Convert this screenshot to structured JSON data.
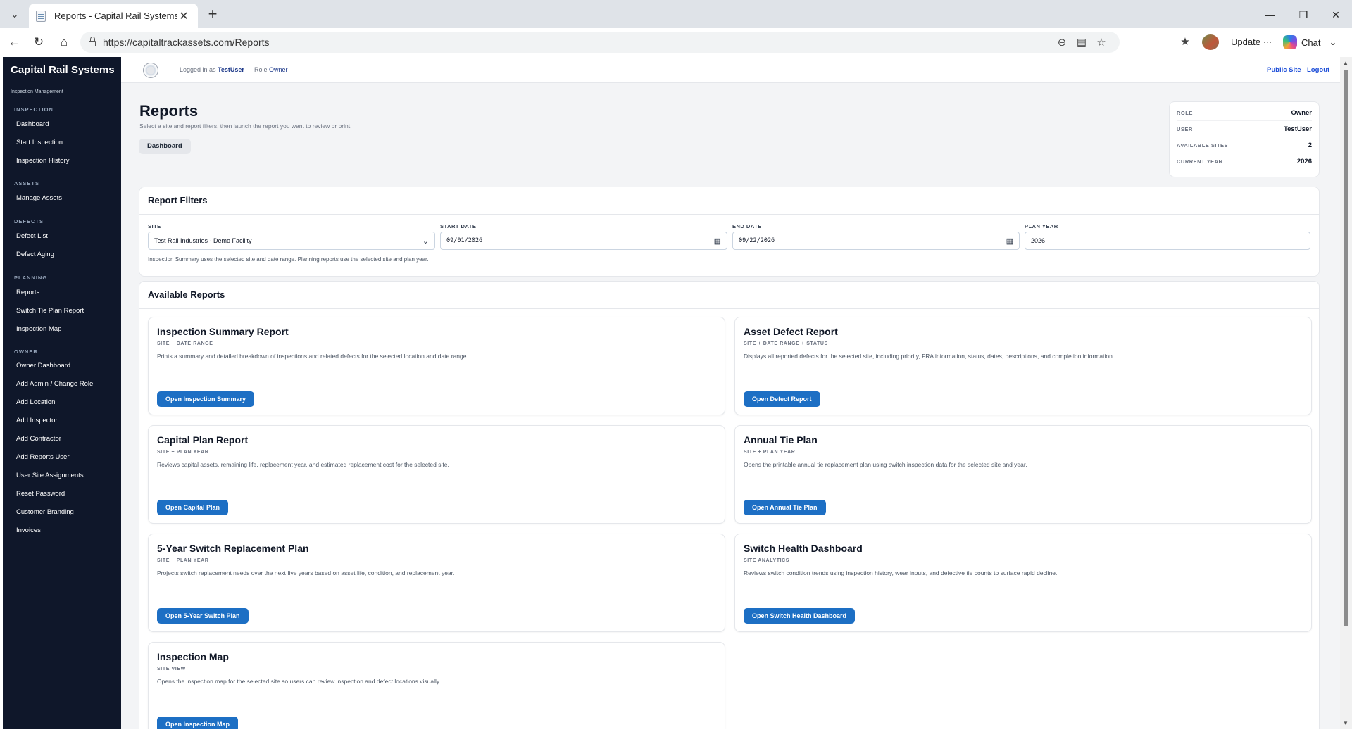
{
  "browser": {
    "tab_title": "Reports - Capital Rail Systems",
    "url": "https://capitaltrackassets.com/Reports",
    "update_label": "Update",
    "chat_label": "Chat"
  },
  "sidebar": {
    "brand_title": "Capital Rail Systems",
    "brand_subtitle": "Inspection Management",
    "sections": [
      {
        "title": "INSPECTION",
        "items": [
          "Dashboard",
          "Start Inspection",
          "Inspection History"
        ]
      },
      {
        "title": "ASSETS",
        "items": [
          "Manage Assets"
        ]
      },
      {
        "title": "DEFECTS",
        "items": [
          "Defect List",
          "Defect Aging"
        ]
      },
      {
        "title": "PLANNING",
        "items": [
          "Reports",
          "Switch Tie Plan Report",
          "Inspection Map"
        ]
      },
      {
        "title": "OWNER",
        "items": [
          "Owner Dashboard",
          "Add Admin / Change Role",
          "Add Location",
          "Add Inspector",
          "Add Contractor",
          "Add Reports User",
          "User Site Assignments",
          "Reset Password",
          "Customer Branding",
          "Invoices"
        ]
      }
    ]
  },
  "topbar": {
    "logged_in_label": "Logged in as",
    "username": "TestUser",
    "separator": "·",
    "role_label": "Role",
    "role": "Owner",
    "public_site": "Public Site",
    "logout": "Logout"
  },
  "page": {
    "title": "Reports",
    "description": "Select a site and report filters, then launch the report you want to review or print.",
    "breadcrumb": "Dashboard"
  },
  "info": [
    {
      "label": "ROLE",
      "value": "Owner"
    },
    {
      "label": "USER",
      "value": "TestUser"
    },
    {
      "label": "AVAILABLE SITES",
      "value": "2"
    },
    {
      "label": "CURRENT YEAR",
      "value": "2026"
    }
  ],
  "filters": {
    "title": "Report Filters",
    "site_label": "SITE",
    "site_value": "Test Rail Industries - Demo Facility",
    "start_label": "START DATE",
    "start_value": "09/01/2026",
    "end_label": "END DATE",
    "end_value": "09/22/2026",
    "plan_year_label": "PLAN YEAR",
    "plan_year_value": "2026",
    "note": "Inspection Summary uses the selected site and date range. Planning reports use the selected site and plan year."
  },
  "reports": {
    "title": "Available Reports",
    "items": [
      {
        "title": "Inspection Summary Report",
        "tag": "SITE + DATE RANGE",
        "desc": "Prints a summary and detailed breakdown of inspections and related defects for the selected location and date range.",
        "button": "Open Inspection Summary"
      },
      {
        "title": "Asset Defect Report",
        "tag": "SITE + DATE RANGE + STATUS",
        "desc": "Displays all reported defects for the selected site, including priority, FRA information, status, dates, descriptions, and completion information.",
        "button": "Open Defect Report"
      },
      {
        "title": "Capital Plan Report",
        "tag": "SITE + PLAN YEAR",
        "desc": "Reviews capital assets, remaining life, replacement year, and estimated replacement cost for the selected site.",
        "button": "Open Capital Plan"
      },
      {
        "title": "Annual Tie Plan",
        "tag": "SITE + PLAN YEAR",
        "desc": "Opens the printable annual tie replacement plan using switch inspection data for the selected site and year.",
        "button": "Open Annual Tie Plan"
      },
      {
        "title": "5-Year Switch Replacement Plan",
        "tag": "SITE + PLAN YEAR",
        "desc": "Projects switch replacement needs over the next five years based on asset life, condition, and replacement year.",
        "button": "Open 5-Year Switch Plan"
      },
      {
        "title": "Switch Health Dashboard",
        "tag": "SITE ANALYTICS",
        "desc": "Reviews switch condition trends using inspection history, wear inputs, and defective tie counts to surface rapid decline.",
        "button": "Open Switch Health Dashboard"
      },
      {
        "title": "Inspection Map",
        "tag": "SITE VIEW",
        "desc": "Opens the inspection map for the selected site so users can review inspection and defect locations visually.",
        "button": "Open Inspection Map"
      }
    ]
  }
}
